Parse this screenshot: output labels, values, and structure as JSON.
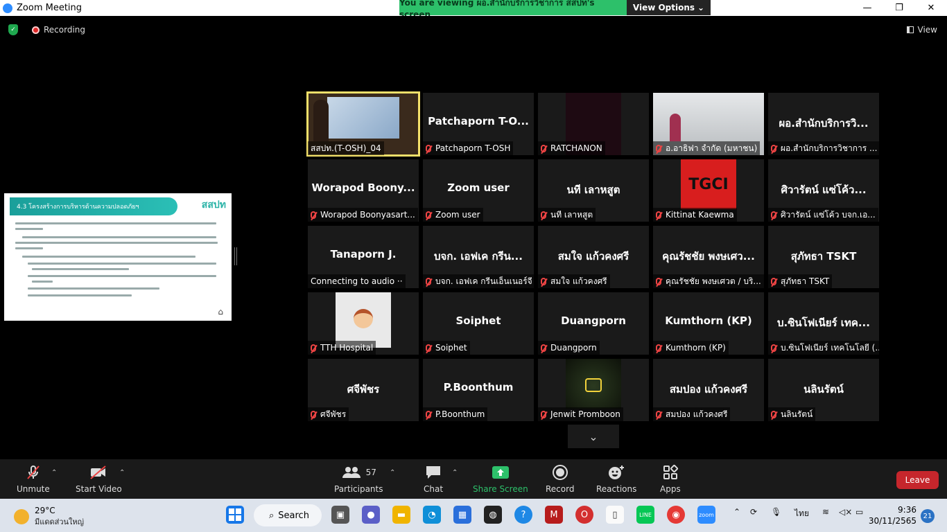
{
  "window": {
    "title": "Zoom Meeting",
    "minimize": "—",
    "maximize": "❐",
    "close": "✕"
  },
  "banner": {
    "viewing": "You are viewing ผอ.สำนักบริการวิชาการ สสปท's screen",
    "view_options": "View Options"
  },
  "top": {
    "recording": "Recording",
    "view": "View"
  },
  "shared": {
    "heading": "4.3 โครงสร้างการบริหารด้านความปลอดภัยฯ",
    "logo": "สสปท"
  },
  "tiles": [
    {
      "big": "",
      "label": "สสปท.(T-OSH)_04",
      "muted": false,
      "active": true,
      "video": "presenter"
    },
    {
      "big": "Patchaporn  T-O...",
      "label": "Patchaporn T-OSH",
      "muted": true
    },
    {
      "big": "",
      "label": "RATCHANON",
      "muted": true,
      "video": "dark"
    },
    {
      "big": "",
      "label": "อ.อาธิฟา จำกัด (มหาชน)",
      "muted": true,
      "video": "room"
    },
    {
      "big": "ผอ.สำนักบริการวิ...",
      "label": "ผอ.สำนักบริการวิชาการ ...",
      "muted": true
    },
    {
      "big": "Worapod  Boony...",
      "label": "Worapod Boonyasart...",
      "muted": true
    },
    {
      "big": "Zoom user",
      "label": "Zoom user",
      "muted": true
    },
    {
      "big": "นที  เลาหสูต",
      "label": "นที  เลาหสูต",
      "muted": true
    },
    {
      "big": "",
      "label": "Kittinat Kaewma",
      "muted": true,
      "video": "tgci",
      "logo_text": "TGCI"
    },
    {
      "big": "ศิวารัตน์  แซ่โค้ว...",
      "label": "ศิวารัตน์  แซ่โค้ว บจก.เอ...",
      "muted": true
    },
    {
      "big": "Tanaporn J.",
      "label": "Connecting to audio ··",
      "muted": false
    },
    {
      "big": "บจก. เอฟเค กรีน...",
      "label": "บจก. เอฟเค กรีนเอ็นเนอร์จี",
      "muted": true
    },
    {
      "big": "สมใจ แก้วคงศรี",
      "label": "สมใจ แก้วคงศรี",
      "muted": true
    },
    {
      "big": "คุณรัชชัย พงษเศว...",
      "label": "คุณรัชชัย พงษเศวต / บริ...",
      "muted": true
    },
    {
      "big": "สุภัทธา TSKT",
      "label": "สุภัทธา TSKT",
      "muted": true
    },
    {
      "big": "",
      "label": "TTH Hospital",
      "muted": true,
      "video": "cartoon"
    },
    {
      "big": "Soiphet",
      "label": "Soiphet",
      "muted": true
    },
    {
      "big": "Duangporn",
      "label": "Duangporn",
      "muted": true
    },
    {
      "big": "Kumthorn (KP)",
      "label": "Kumthorn (KP)",
      "muted": true
    },
    {
      "big": "บ.ซินโฟเนียร์ เทค...",
      "label": "บ.ซินโฟเนียร์ เทคโนโลยี (...",
      "muted": true
    },
    {
      "big": "ศจีพัชร",
      "label": "ศจีพัชร",
      "muted": true
    },
    {
      "big": "P.Boonthum",
      "label": "P.Boonthum",
      "muted": true
    },
    {
      "big": "",
      "label": "Jenwit Promboon",
      "muted": true,
      "video": "hood"
    },
    {
      "big": "สมปอง  แก้วคงศรี",
      "label": "สมปอง  แก้วคงศรี",
      "muted": true
    },
    {
      "big": "นลินรัตน์",
      "label": "นลินรัตน์",
      "muted": true
    }
  ],
  "toolbar": {
    "unmute": "Unmute",
    "start_video": "Start Video",
    "participants": "Participants",
    "participants_count": "57",
    "chat": "Chat",
    "share_screen": "Share Screen",
    "record": "Record",
    "reactions": "Reactions",
    "apps": "Apps",
    "leave": "Leave"
  },
  "taskbar": {
    "temp": "29°C",
    "weather": "มีแดดส่วนใหญ่",
    "search": "Search",
    "lang": "ไทย",
    "time": "9:36",
    "date": "30/11/2565",
    "notifications": "21"
  },
  "colors": {
    "accent_green": "#2dc06a",
    "leave_red": "#c6262c",
    "active_speaker": "#f3e06a"
  }
}
